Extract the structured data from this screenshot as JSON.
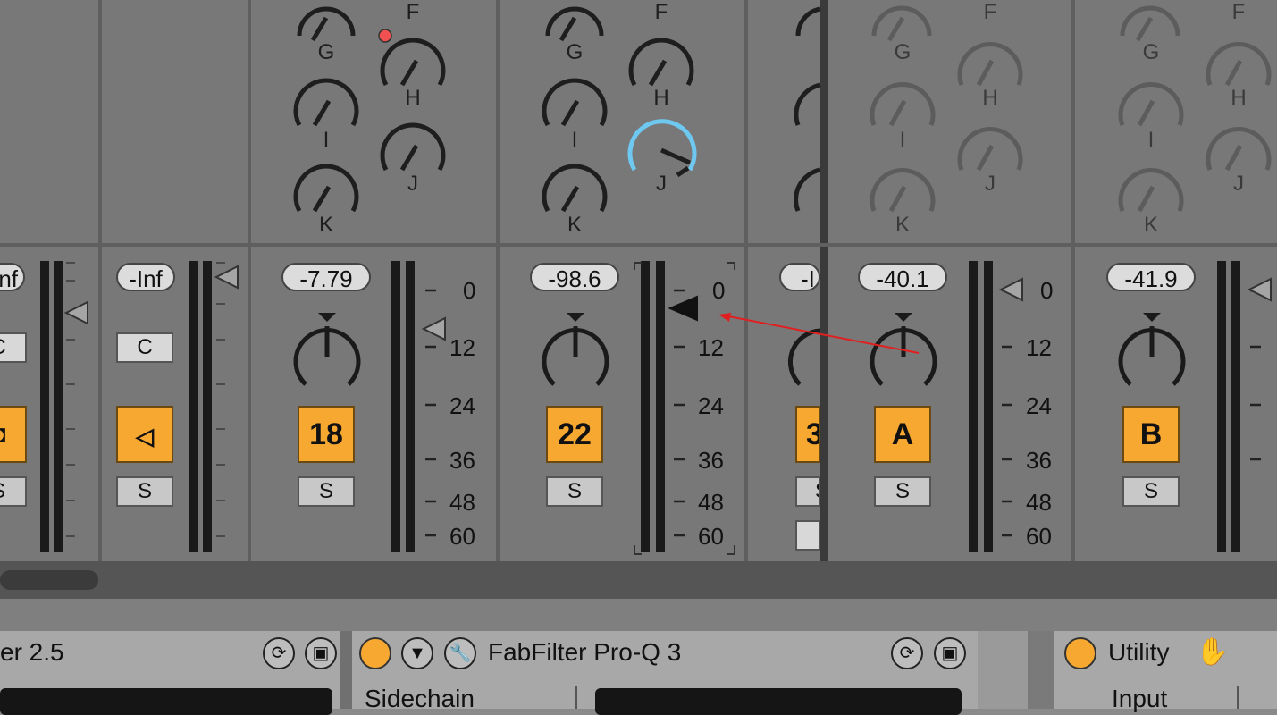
{
  "knob_labels": {
    "s3": [
      "F",
      "G",
      "H",
      "I",
      "J",
      "K"
    ],
    "s4": [
      "F",
      "G",
      "H",
      "I",
      "J",
      "K"
    ],
    "s6": [
      "F",
      "G",
      "H",
      "I",
      "J",
      "K"
    ],
    "s7": [
      "F",
      "G",
      "H",
      "I",
      "J",
      "K"
    ]
  },
  "strips": [
    {
      "volume": "nf",
      "send_button": "C",
      "track_button": "",
      "solo": "S"
    },
    {
      "volume": "-Inf",
      "send_button": "C",
      "track_button": "speaker",
      "solo": "S"
    },
    {
      "volume": "-7.79",
      "track_button": "18",
      "solo": "S"
    },
    {
      "volume": "-98.6",
      "track_button": "22",
      "solo": "S"
    },
    {
      "volume": "-I",
      "track_button": "3",
      "solo": "S"
    },
    {
      "volume": "-40.1",
      "track_button": "A",
      "solo": "S"
    },
    {
      "volume": "-41.9",
      "track_button": "B",
      "solo": "S"
    }
  ],
  "meter_scale": [
    "0",
    "12",
    "24",
    "36",
    "48",
    "60"
  ],
  "devices": {
    "left_title": "er 2.5",
    "center_title": "FabFilter Pro-Q 3",
    "center_sub": "Sidechain",
    "right_title": "Utility",
    "right_sub": "Input"
  },
  "colors": {
    "accent": "#f7a831",
    "knob_highlight": "#6ec8f0",
    "annotation": "#e02020"
  }
}
